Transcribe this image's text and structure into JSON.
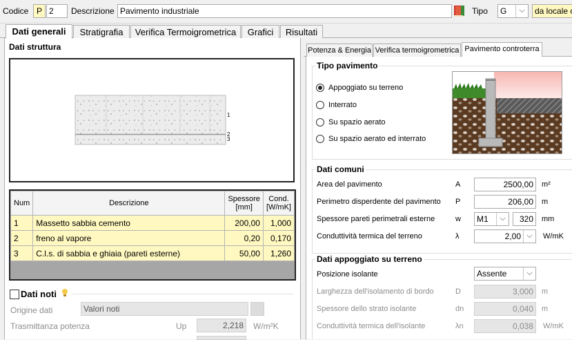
{
  "header": {
    "codice_label": "Codice",
    "codice_prefix": "P",
    "codice_value": "2",
    "descrizione_label": "Descrizione",
    "descrizione_value": "Pavimento industriale",
    "tipo_label": "Tipo",
    "tipo_value": "G",
    "location_value": "da locale cli"
  },
  "main_tabs": [
    "Dati generali",
    "Stratigrafia",
    "Verifica Termoigrometrica",
    "Grafici",
    "Risultati"
  ],
  "left": {
    "structure_title": "Dati struttura",
    "layer_labels": [
      "1",
      "2",
      "3"
    ],
    "table": {
      "headers": [
        "Num",
        "Descrizione",
        "Spessore\n[mm]",
        "Cond.\n[W/mK]"
      ],
      "rows": [
        {
          "num": "1",
          "desc": "Massetto sabbia cemento",
          "spessore": "200,00",
          "cond": "1,000"
        },
        {
          "num": "2",
          "desc": "freno al vapore",
          "spessore": "0,20",
          "cond": "0,170"
        },
        {
          "num": "3",
          "desc": "C.l.s. di sabbia e ghiaia (pareti esterne)",
          "spessore": "50,00",
          "cond": "1,260"
        }
      ]
    },
    "dati_noti_label": "Dati noti",
    "origine_label": "Origine dati",
    "origine_value": "Valori noti",
    "trasmittanza_label": "Trasmittanza potenza",
    "trasmittanza_symbol": "Up",
    "trasmittanza_value": "2,218",
    "trasmittanza_unit": "W/m²K"
  },
  "right": {
    "tabs": [
      "Potenza & Energia",
      "Verifica termoigrometrica",
      "Pavimento controterra"
    ],
    "tipo_pavimento_title": "Tipo pavimento",
    "radio_options": [
      "Appoggiato su terreno",
      "Interrato",
      "Su spazio aerato",
      "Su spazio aerato ed interrato"
    ],
    "selected_radio": 0,
    "dati_comuni_title": "Dati comuni",
    "area_label": "Area del pavimento",
    "area_symbol": "A",
    "area_value": "2500,00",
    "area_unit": "m²",
    "perimetro_label": "Perimetro disperdente del pavimento",
    "perimetro_symbol": "P",
    "perimetro_value": "206,00",
    "perimetro_unit": "m",
    "spessore_label": "Spessore pareti perimetrali esterne",
    "spessore_symbol": "w",
    "spessore_combo": "M1",
    "spessore_value": "320",
    "spessore_unit": "mm",
    "cond_label": "Conduttività termica del terreno",
    "cond_symbol": "λ",
    "cond_value": "2,00",
    "cond_unit": "W/mK",
    "appoggiato_title": "Dati appoggiato su terreno",
    "posizione_label": "Posizione isolante",
    "posizione_value": "Assente",
    "larghezza_label": "Larghezza dell'isolamento di bordo",
    "larghezza_symbol": "D",
    "larghezza_value": "3,000",
    "larghezza_unit": "m",
    "spessore_iso_label": "Spessore dello strato isolante",
    "spessore_iso_symbol": "dn",
    "spessore_iso_value": "0,040",
    "spessore_iso_unit": "m",
    "cond_iso_label": "Conduttività termica dell'isolante",
    "cond_iso_symbol": "λn",
    "cond_iso_value": "0,038",
    "cond_iso_unit": "W/mK"
  }
}
